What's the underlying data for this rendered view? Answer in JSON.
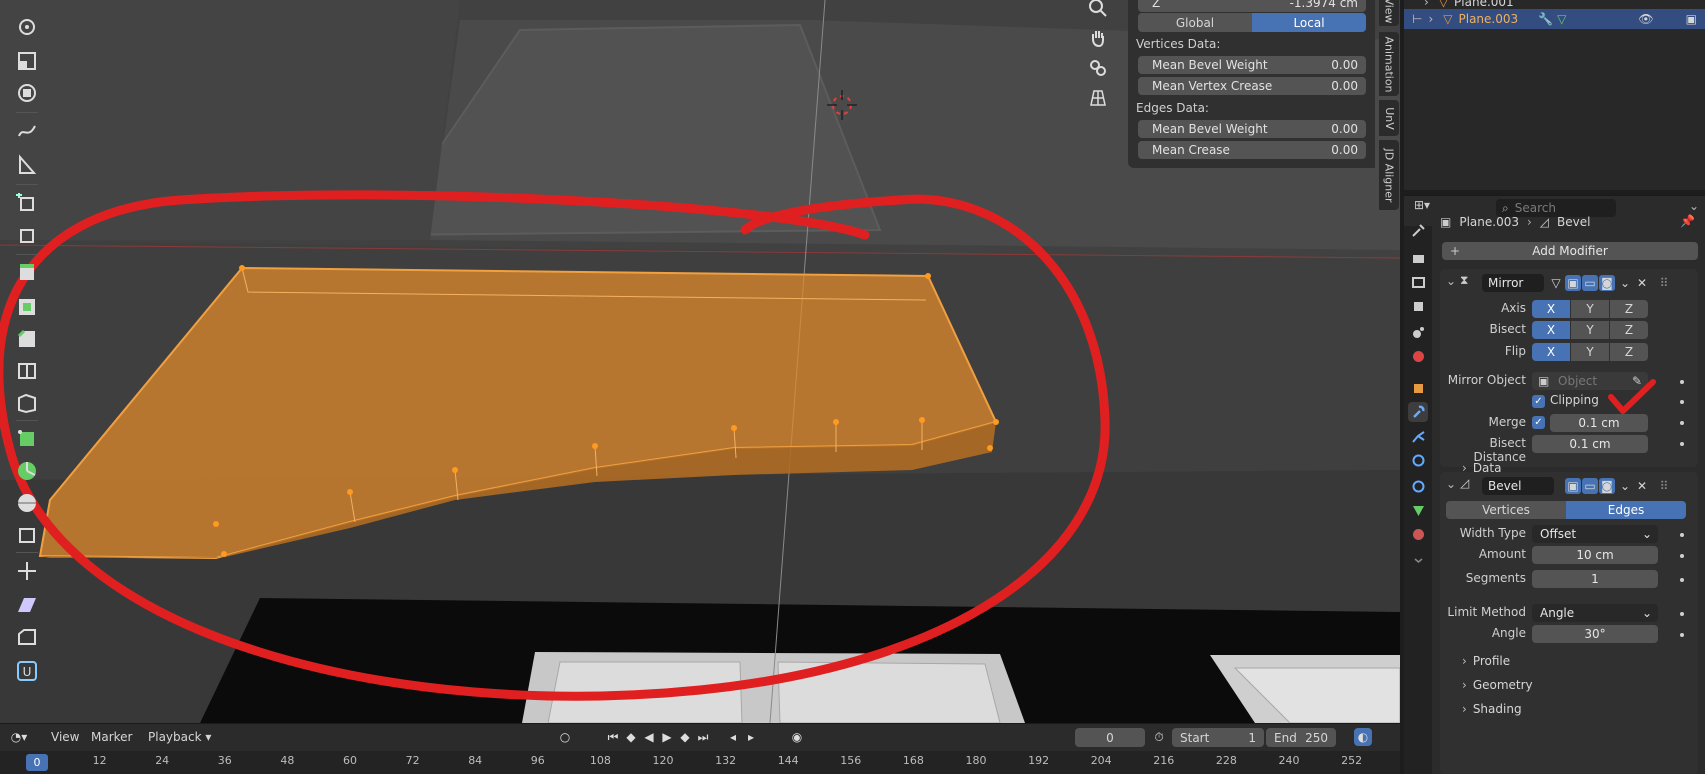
{
  "npanel": {
    "z_label": "Z",
    "z_value": "-1.3974 cm",
    "global_label": "Global",
    "local_label": "Local",
    "vertices_heading": "Vertices Data:",
    "mean_bevel_weight_v_label": "Mean Bevel Weight",
    "mean_bevel_weight_v_value": "0.00",
    "mean_vertex_crease_label": "Mean Vertex Crease",
    "mean_vertex_crease_value": "0.00",
    "edges_heading": "Edges Data:",
    "mean_bevel_weight_e_label": "Mean Bevel Weight",
    "mean_bevel_weight_e_value": "0.00",
    "mean_crease_label": "Mean Crease",
    "mean_crease_value": "0.00"
  },
  "ntabs": [
    "View",
    "Animation",
    "UnV",
    "JD Aligner"
  ],
  "outliner": {
    "row1": "Plane.001",
    "row2": "Plane.003"
  },
  "props": {
    "search_placeholder": "Search",
    "breadcrumb_object": "Plane.003",
    "breadcrumb_modifier": "Bevel",
    "add_modifier": "Add Modifier",
    "mirror": {
      "name": "Mirror",
      "axis_label": "Axis",
      "bisect_label": "Bisect",
      "flip_label": "Flip",
      "x": "X",
      "y": "Y",
      "z": "Z",
      "mirror_object_label": "Mirror Object",
      "object_placeholder": "Object",
      "clipping_label": "Clipping",
      "merge_label": "Merge",
      "merge_value": "0.1 cm",
      "bisect_distance_label": "Bisect Distance",
      "bisect_distance_value": "0.1 cm",
      "data_label": "Data"
    },
    "bevel": {
      "name": "Bevel",
      "vertices_label": "Vertices",
      "edges_label": "Edges",
      "width_type_label": "Width Type",
      "width_type_value": "Offset",
      "amount_label": "Amount",
      "amount_value": "10 cm",
      "segments_label": "Segments",
      "segments_value": "1",
      "limit_method_label": "Limit Method",
      "limit_method_value": "Angle",
      "angle_label": "Angle",
      "angle_value": "30°",
      "profile_label": "Profile",
      "geometry_label": "Geometry",
      "shading_label": "Shading"
    }
  },
  "timeline": {
    "view_menu": "View",
    "marker_menu": "Marker",
    "playback_menu": "Playback",
    "current_frame": "0",
    "start_label": "Start",
    "start_value": "1",
    "end_label": "End",
    "end_value": "250",
    "ruler_current": "0",
    "ticks": [
      "12",
      "24",
      "36",
      "48",
      "60",
      "72",
      "84",
      "96",
      "108",
      "120",
      "132",
      "144",
      "156",
      "168",
      "180",
      "192",
      "204",
      "216",
      "228",
      "240",
      "252"
    ]
  },
  "colors": {
    "accent_blue": "#4772b3",
    "selection_orange": "#e08a2c",
    "annotation_red": "#e02020"
  },
  "icons": {
    "toolbar": [
      "rotate-icon",
      "scale-icon",
      "transform-icon",
      "annotate-icon",
      "measure-icon",
      "add-cube-icon",
      "extrude-icon",
      "inset-icon",
      "bevel-icon",
      "loop-cut-icon",
      "knife-icon",
      "poly-build-icon",
      "spin-icon",
      "smooth-icon",
      "edge-slide-icon",
      "shrink-fatten-icon",
      "shear-icon",
      "rip-icon",
      "uv-icon"
    ]
  }
}
